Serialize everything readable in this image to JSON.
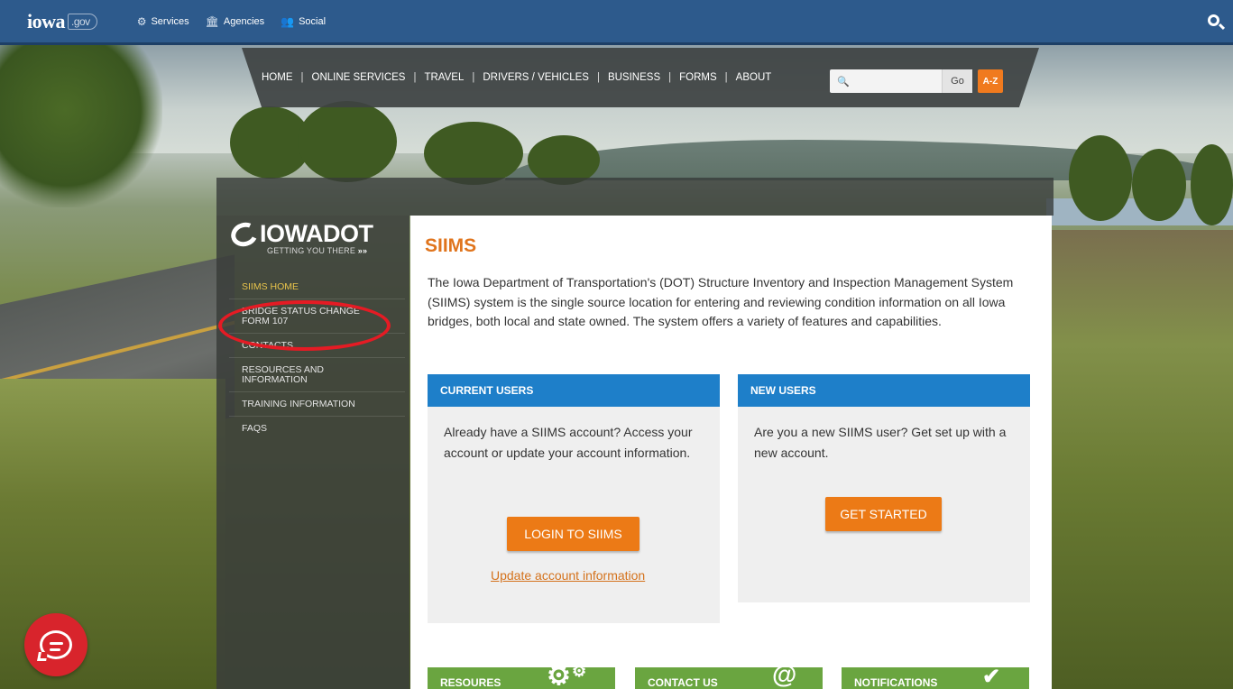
{
  "topbar": {
    "logo_main": "iowa",
    "logo_suffix": ".gov",
    "nav": [
      {
        "label": "Services",
        "icon": "gears-icon"
      },
      {
        "label": "Agencies",
        "icon": "building-icon"
      },
      {
        "label": "Social",
        "icon": "people-icon"
      }
    ],
    "search_icon": "search-icon"
  },
  "mainnav": {
    "links": [
      "HOME",
      "ONLINE SERVICES",
      "TRAVEL",
      "DRIVERS / VEHICLES",
      "BUSINESS",
      "FORMS",
      "ABOUT"
    ],
    "search_placeholder": "",
    "go_label": "Go",
    "az_label": "A-Z"
  },
  "dot_logo": {
    "name": "IOWADOT",
    "tagline": "GETTING YOU THERE",
    "tagline_mark": "»»"
  },
  "sidebar": {
    "items": [
      {
        "label": "SIIMS HOME",
        "active": true
      },
      {
        "label": "BRIDGE STATUS CHANGE FORM 107",
        "active": false
      },
      {
        "label": "CONTACTS",
        "active": false
      },
      {
        "label": "RESOURCES AND INFORMATION",
        "active": false
      },
      {
        "label": "TRAINING INFORMATION",
        "active": false
      },
      {
        "label": "FAQS",
        "active": false
      }
    ]
  },
  "content": {
    "title": "SIIMS",
    "intro": "The Iowa Department of Transportation's (DOT) Structure Inventory and Inspection Management System (SIIMS) system is the single source location for entering and reviewing condition information on all Iowa bridges, both local and state owned. The system offers a variety of features and capabilities.",
    "current_users": {
      "header": "CURRENT USERS",
      "body": "Already have a SIIMS account? Access your account or update your account information.",
      "button": "LOGIN TO SIIMS",
      "link": "Update account information"
    },
    "new_users": {
      "header": "NEW USERS",
      "body": "Are you a new SIIMS user? Get set up with a new account.",
      "button": "GET STARTED"
    },
    "tiles": [
      {
        "label": "RESOURES",
        "icon": "gear-icon"
      },
      {
        "label": "CONTACT US",
        "icon": "at-icon",
        "glyph": "@"
      },
      {
        "label": "NOTIFICATIONS",
        "icon": "check-icon",
        "glyph": "✔"
      }
    ]
  },
  "colors": {
    "topbar": "#2d5a8c",
    "accent_orange": "#ec7a16",
    "card_header_blue": "#1e7fc9",
    "tile_green": "#6aa540",
    "highlight_red": "#e51b24"
  },
  "chat": {
    "icon": "chat-icon"
  }
}
